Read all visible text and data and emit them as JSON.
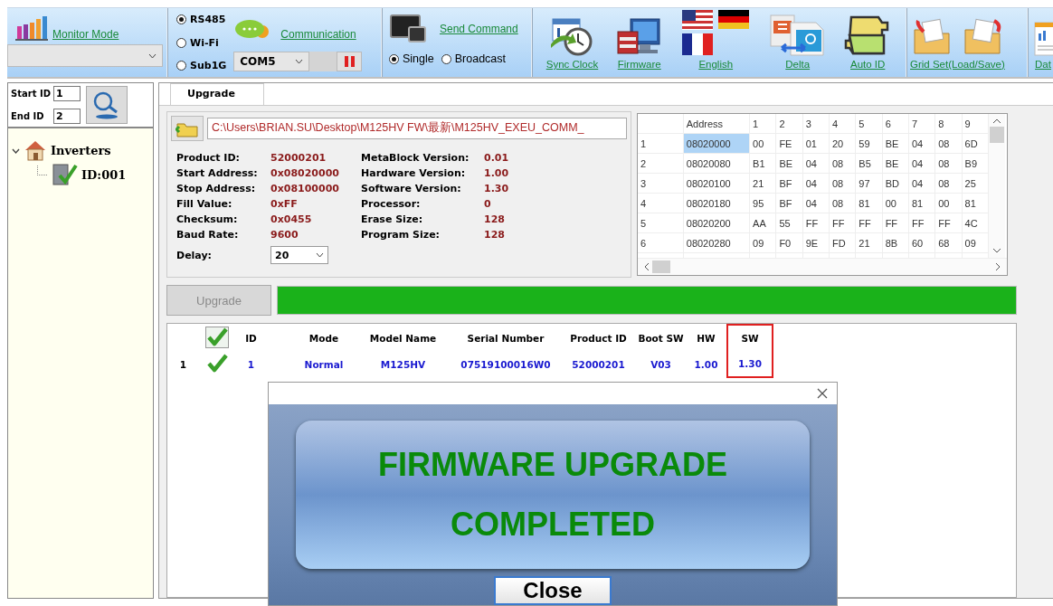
{
  "toolbar": {
    "monitor": {
      "label": "Monitor Mode"
    },
    "connection_modes": [
      {
        "label": "RS485",
        "selected": true
      },
      {
        "label": "Wi-Fi",
        "selected": false
      },
      {
        "label": "Sub1G",
        "selected": false
      }
    ],
    "communication": {
      "label": "Communication",
      "port": "COM5"
    },
    "send_command": {
      "label": "Send Command",
      "targets": [
        {
          "label": "Single",
          "selected": true
        },
        {
          "label": "Broadcast",
          "selected": false
        }
      ]
    },
    "tools": [
      {
        "label": "Sync Clock",
        "kind": "clock"
      },
      {
        "label": "Firmware",
        "kind": "firmware"
      },
      {
        "label": "English",
        "kind": "flags"
      },
      {
        "label": "Delta",
        "kind": "delta"
      },
      {
        "label": "Auto ID",
        "kind": "puzzle"
      }
    ],
    "grid_set": {
      "label": "Grid Set(Load/Save)"
    },
    "data": {
      "label": "Dat"
    }
  },
  "search": {
    "start_label": "Start ID",
    "start_value": "1",
    "end_label": "End ID",
    "end_value": "2"
  },
  "tree": [
    {
      "label": "Inverters",
      "expanded": true,
      "children": [
        {
          "label": "ID:001"
        }
      ]
    }
  ],
  "tabs": [
    {
      "label": "Upgrade",
      "selected": true
    }
  ],
  "file_path": "C:\\Users\\BRIAN.SU\\Desktop\\M125HV FW\\最新\\M125HV_EXEU_COMM_",
  "info_left": [
    {
      "label": "Product ID:",
      "value": "52000201"
    },
    {
      "label": "Start Address:",
      "value": "0x08020000"
    },
    {
      "label": "Stop Address:",
      "value": "0x08100000"
    },
    {
      "label": "Fill Value:",
      "value": "0xFF"
    },
    {
      "label": "Checksum:",
      "value": "0x0455"
    },
    {
      "label": "Baud Rate:",
      "value": "9600"
    }
  ],
  "info_right": [
    {
      "label": "MetaBlock Version:",
      "value": "0.01"
    },
    {
      "label": "Hardware Version:",
      "value": "1.00"
    },
    {
      "label": "Software Version:",
      "value": "1.30"
    },
    {
      "label": "Processor:",
      "value": "0"
    },
    {
      "label": "Erase Size:",
      "value": "128"
    },
    {
      "label": "Program Size:",
      "value": "128"
    }
  ],
  "delay": {
    "label": "Delay:",
    "value": "20"
  },
  "hex_table": {
    "columns": [
      "Address",
      "1",
      "2",
      "3",
      "4",
      "5",
      "6",
      "7",
      "8",
      "9"
    ],
    "rows": [
      {
        "index": "1",
        "address": "08020000",
        "selected": true,
        "bytes": [
          "00",
          "FE",
          "01",
          "20",
          "59",
          "BE",
          "04",
          "08",
          "6D"
        ]
      },
      {
        "index": "2",
        "address": "08020080",
        "selected": false,
        "bytes": [
          "B1",
          "BE",
          "04",
          "08",
          "B5",
          "BE",
          "04",
          "08",
          "B9"
        ]
      },
      {
        "index": "3",
        "address": "08020100",
        "selected": false,
        "bytes": [
          "21",
          "BF",
          "04",
          "08",
          "97",
          "BD",
          "04",
          "08",
          "25"
        ]
      },
      {
        "index": "4",
        "address": "08020180",
        "selected": false,
        "bytes": [
          "95",
          "BF",
          "04",
          "08",
          "81",
          "00",
          "81",
          "00",
          "81"
        ]
      },
      {
        "index": "5",
        "address": "08020200",
        "selected": false,
        "bytes": [
          "AA",
          "55",
          "FF",
          "FF",
          "FF",
          "FF",
          "FF",
          "FF",
          "4C"
        ]
      },
      {
        "index": "6",
        "address": "08020280",
        "selected": false,
        "bytes": [
          "09",
          "F0",
          "9E",
          "FD",
          "21",
          "8B",
          "60",
          "68",
          "09"
        ]
      }
    ]
  },
  "upgrade_button": {
    "label": "Upgrade",
    "disabled": true
  },
  "progress": {
    "level": 1
  },
  "device_table": {
    "select_all_checked": true,
    "columns": [
      {
        "label": "ID",
        "highlighted": false
      },
      {
        "label": "Mode",
        "highlighted": false
      },
      {
        "label": "Model Name",
        "highlighted": false
      },
      {
        "label": "Serial Number",
        "highlighted": false
      },
      {
        "label": "Product ID",
        "highlighted": false
      },
      {
        "label": "Boot SW",
        "highlighted": false
      },
      {
        "label": "HW",
        "highlighted": false
      },
      {
        "label": "SW",
        "highlighted": true
      }
    ],
    "rows": [
      {
        "index": "1",
        "checked": true,
        "cells": [
          "1",
          "Normal",
          "M125HV",
          "07519100016W0",
          "52000201",
          "V03",
          "1.00",
          "1.30"
        ]
      }
    ]
  },
  "dialog": {
    "message_lines": [
      "FIRMWARE UPGRADE",
      "COMPLETED"
    ],
    "button": "Close"
  }
}
